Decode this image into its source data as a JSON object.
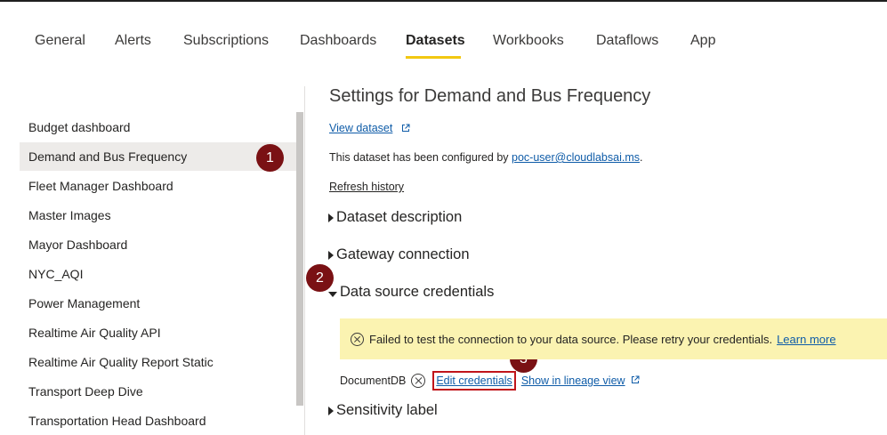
{
  "tabs": [
    {
      "label": "General",
      "active": false
    },
    {
      "label": "Alerts",
      "active": false
    },
    {
      "label": "Subscriptions",
      "active": false
    },
    {
      "label": "Dashboards",
      "active": false
    },
    {
      "label": "Datasets",
      "active": true
    },
    {
      "label": "Workbooks",
      "active": false
    },
    {
      "label": "Dataflows",
      "active": false
    },
    {
      "label": "App",
      "active": false
    }
  ],
  "sidebar": {
    "items": [
      {
        "label": "Budget dashboard"
      },
      {
        "label": "Demand and Bus Frequency",
        "selected": true
      },
      {
        "label": "Fleet Manager Dashboard"
      },
      {
        "label": "Master Images"
      },
      {
        "label": "Mayor Dashboard"
      },
      {
        "label": "NYC_AQI"
      },
      {
        "label": "Power Management"
      },
      {
        "label": "Realtime Air Quality API"
      },
      {
        "label": "Realtime Air Quality Report Static"
      },
      {
        "label": "Transport Deep Dive"
      },
      {
        "label": "Transportation Head Dashboard"
      }
    ]
  },
  "markers": [
    "1",
    "2",
    "3"
  ],
  "main": {
    "title": "Settings for Demand and Bus Frequency",
    "view_dataset": "View dataset",
    "configured_prefix": "This dataset has been configured by ",
    "configured_user": "poc-user@cloudlabsai.ms",
    "configured_suffix": ".",
    "refresh_history": "Refresh history",
    "sections": {
      "dataset_description": "Dataset description",
      "gateway_connection": "Gateway connection",
      "data_source_credentials": "Data source credentials",
      "sensitivity_label": "Sensitivity label"
    },
    "warning": {
      "message": "Failed to test the connection to your data source. Please retry your credentials.",
      "learn_more": "Learn more"
    },
    "data_source": {
      "name": "DocumentDB",
      "edit_credentials": "Edit credentials",
      "show_lineage": "Show in lineage view"
    }
  },
  "colors": {
    "accent_underline": "#f2c811",
    "link": "#0f5ca8",
    "marker": "#7a1114",
    "warning_bg": "#fbf3b1",
    "highlight_border": "#c0141a"
  },
  "icons": {
    "external_link": "external-link-icon",
    "error": "error-circle-icon",
    "expand": "triangle-right-icon",
    "collapse": "triangle-down-icon"
  }
}
